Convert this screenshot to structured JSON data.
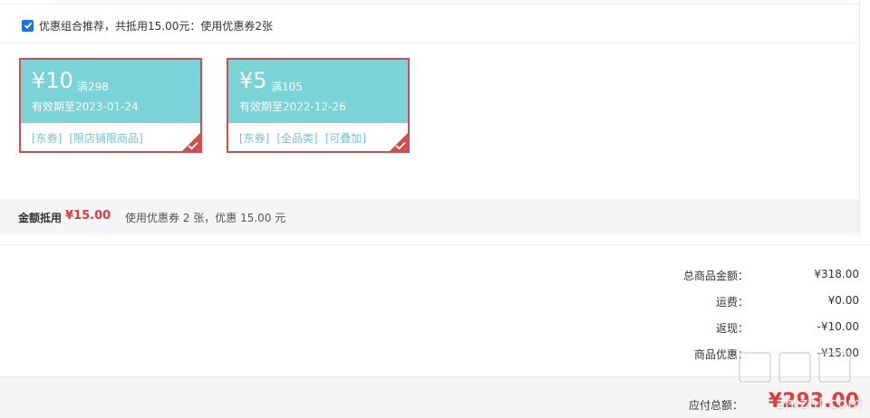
{
  "combo": {
    "checked": true,
    "text": "优惠组合推荐，共抵用15.00元：使用优惠券2张"
  },
  "coupons": [
    {
      "amount": "¥10",
      "condition": "满298",
      "validity": "有效期至2023-01-24",
      "tags": [
        "[东券]",
        "[限店铺限商品]"
      ]
    },
    {
      "amount": "¥5",
      "condition": "满105",
      "validity": "有效期至2022-12-26",
      "tags": [
        "[东券]",
        "[全品类]",
        "[可叠加]"
      ]
    }
  ],
  "summary": {
    "label": "金额抵用",
    "amount": "¥15.00",
    "desc": "使用优惠券 2 张，优惠 15.00 元"
  },
  "totals": [
    {
      "label": "总商品金额：",
      "value": "¥318.00"
    },
    {
      "label": "运费：",
      "value": "¥0.00"
    },
    {
      "label": "返现：",
      "value": "-¥10.00"
    },
    {
      "label": "商品优惠：",
      "value": "-¥15.00"
    }
  ],
  "payable": {
    "label": "应付总额：",
    "value": "¥293.00"
  },
  "watermark": {
    "text": "zhizhi.com",
    "logo": "值值值"
  },
  "colors": {
    "coupon_bg": "#79d3d7",
    "coupon_border": "#d34d4d",
    "accent_red": "#e4393c",
    "tag_text": "#74c4cf"
  }
}
